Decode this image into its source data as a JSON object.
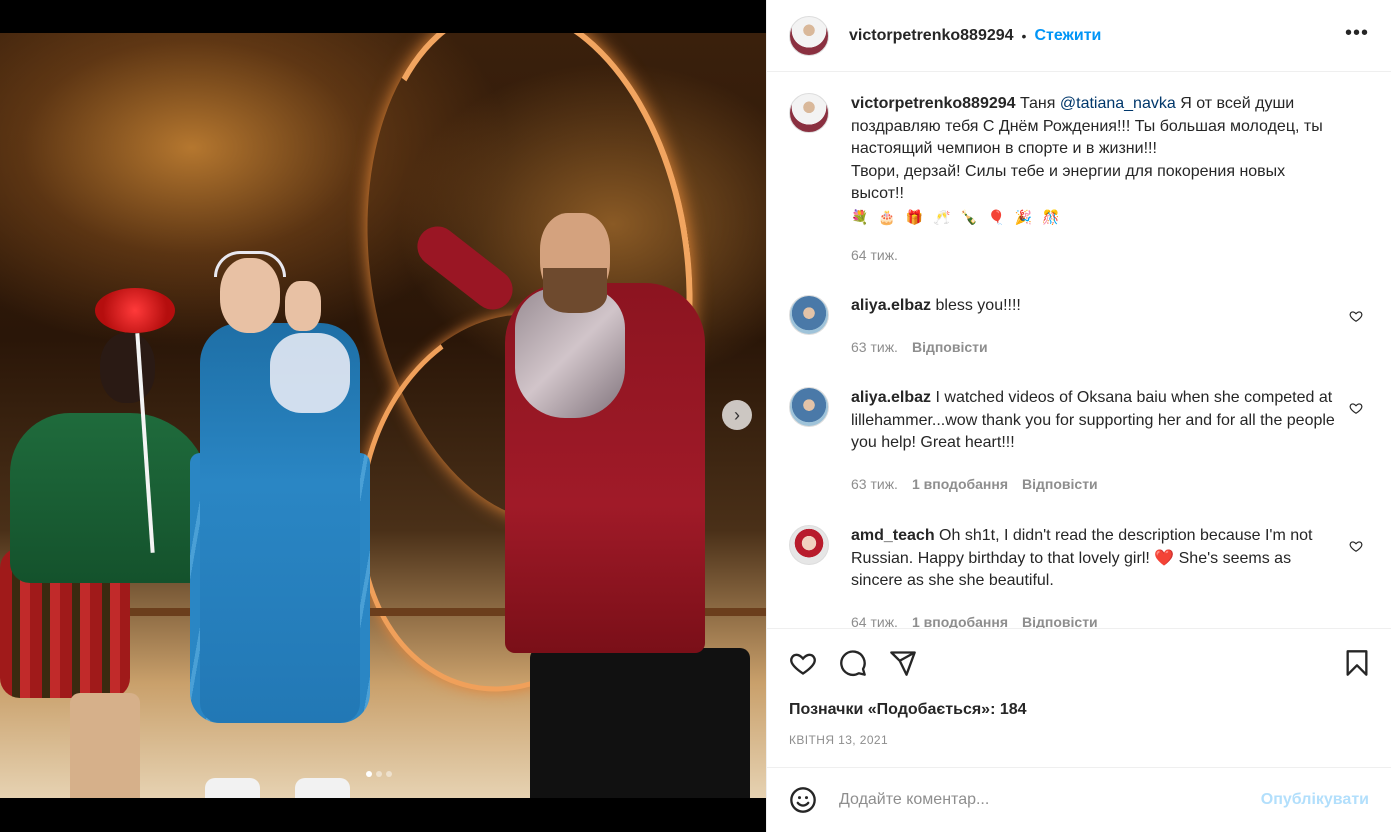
{
  "post": {
    "username": "victorpetrenko889294",
    "follow_label": "Стежити",
    "more_label": "•••",
    "separator": "•"
  },
  "media": {
    "next_label": "›",
    "carousel_count": 3,
    "carousel_active": 1
  },
  "caption": {
    "username": "victorpetrenko889294",
    "text_before": " Таня ",
    "mention": "@tatiana_navka",
    "text_after": " Я от всей души поздравляю тебя С Днём Рождения!!! Ты большая молодец, ты настоящий чемпион в спорте и в жизни!!!",
    "line2": "Твори, дерзай! Силы тебе и энергии для покорения новых высот!!",
    "emojis": "💐 🎂 🎁 🥂 🍾 🎈 🎉 🎊",
    "time": "64 тиж."
  },
  "comments": [
    {
      "username": "aliya.elbaz",
      "text": " bless you!!!!",
      "time": "63 тиж.",
      "likes": "",
      "reply_label": "Відповісти"
    },
    {
      "username": "aliya.elbaz",
      "text": " I watched videos of Oksana baiu when she competed at lillehammer...wow thank you for supporting her and for all the people you help! Great heart!!!",
      "time": "63 тиж.",
      "likes": "1 вподобання",
      "reply_label": "Відповісти"
    },
    {
      "username": "amd_teach",
      "text_before": " Oh sh1t, I didn't read the description because I'm not Russian. Happy birthday to that lovely girl! ",
      "heart": "❤️",
      "text_after": " She's seems as sincere as she she beautiful.",
      "time": "64 тиж.",
      "likes": "1 вподобання",
      "reply_label": "Відповісти"
    }
  ],
  "actions": {
    "likes_text": "Позначки «Подобається»: 184",
    "date": "КВІТНЯ 13, 2021"
  },
  "composer": {
    "placeholder": "Додайте коментар...",
    "post_label": "Опублікувати"
  },
  "colors": {
    "accent": "#0095f6",
    "post_disabled": "#b2dffc",
    "mention": "#00376b",
    "secondary_text": "#8e8e8e"
  }
}
